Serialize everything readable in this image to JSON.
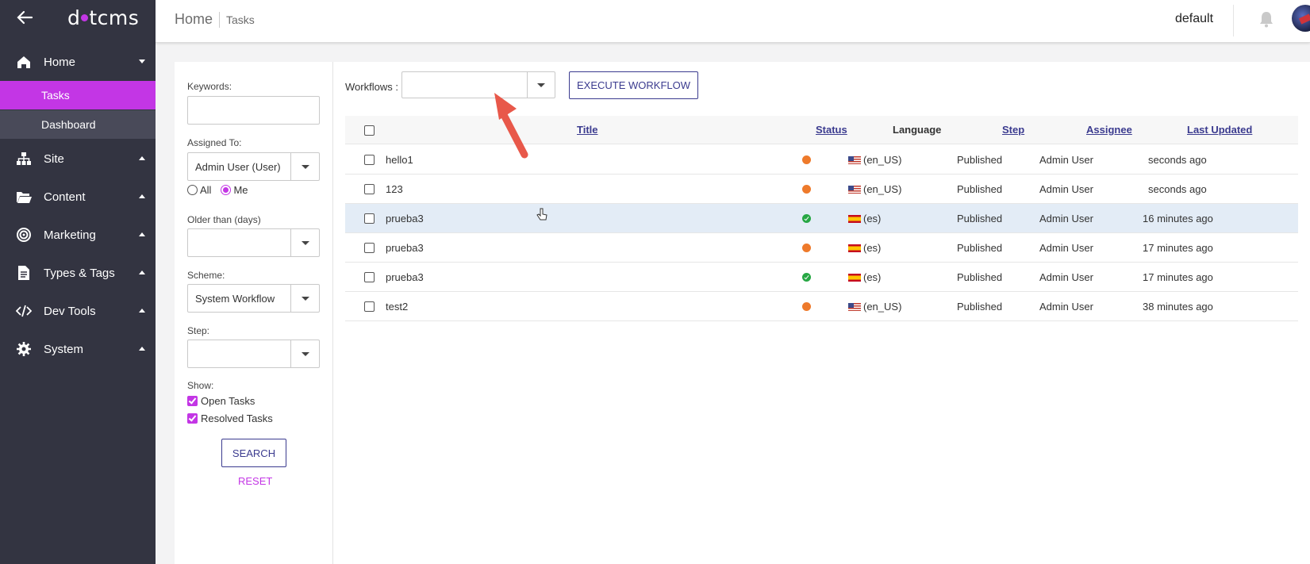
{
  "app": {
    "logo_left": "d",
    "logo_right": "tcms"
  },
  "sidebar": {
    "sections": [
      {
        "label": "Home",
        "icon": "home-icon"
      },
      {
        "label": "Site",
        "icon": "sitemap-icon"
      },
      {
        "label": "Content",
        "icon": "folder-open-icon"
      },
      {
        "label": "Marketing",
        "icon": "target-icon"
      },
      {
        "label": "Types & Tags",
        "icon": "file-text-icon"
      },
      {
        "label": "Dev Tools",
        "icon": "code-icon"
      },
      {
        "label": "System",
        "icon": "gear-icon"
      }
    ],
    "home_items": [
      {
        "label": "Tasks",
        "active": true
      },
      {
        "label": "Dashboard",
        "active": false
      }
    ]
  },
  "header": {
    "home": "Home",
    "page": "Tasks",
    "site": "default"
  },
  "filters": {
    "keywords_label": "Keywords:",
    "keywords_value": "",
    "assigned_label": "Assigned To:",
    "assigned_value": "Admin User (User)",
    "radio_all": "All",
    "radio_me": "Me",
    "older_label": "Older than (days)",
    "older_value": "",
    "scheme_label": "Scheme:",
    "scheme_value": "System Workflow",
    "step_label": "Step:",
    "step_value": "",
    "show_label": "Show:",
    "open_tasks": "Open Tasks",
    "resolved_tasks": "Resolved Tasks",
    "search": "SEARCH",
    "reset": "RESET"
  },
  "toolbar": {
    "workflows_label": "Workflows :",
    "workflows_value": "",
    "execute": "EXECUTE WORKFLOW"
  },
  "table": {
    "headers": {
      "title": "Title",
      "status": "Status",
      "language": "Language",
      "step": "Step",
      "assignee": "Assignee",
      "updated": "Last Updated"
    },
    "rows": [
      {
        "title": "hello1",
        "status": "open",
        "flag": "us",
        "language": "(en_US)",
        "step": "Published",
        "assignee": "Admin User",
        "updated": "seconds ago"
      },
      {
        "title": "123",
        "status": "open",
        "flag": "us",
        "language": "(en_US)",
        "step": "Published",
        "assignee": "Admin User",
        "updated": "seconds ago"
      },
      {
        "title": "prueba3",
        "status": "done",
        "flag": "es",
        "language": "(es)",
        "step": "Published",
        "assignee": "Admin User",
        "updated": "16 minutes ago"
      },
      {
        "title": "prueba3",
        "status": "open",
        "flag": "es",
        "language": "(es)",
        "step": "Published",
        "assignee": "Admin User",
        "updated": "17 minutes ago"
      },
      {
        "title": "prueba3",
        "status": "done",
        "flag": "es",
        "language": "(es)",
        "step": "Published",
        "assignee": "Admin User",
        "updated": "17 minutes ago"
      },
      {
        "title": "test2",
        "status": "open",
        "flag": "us",
        "language": "(en_US)",
        "step": "Published",
        "assignee": "Admin User",
        "updated": "38 minutes ago"
      }
    ]
  },
  "colors": {
    "accent": "#c336e5",
    "sidebar_bg": "#333441",
    "primary": "#3b3b8f",
    "status_open": "#ee7a2b",
    "status_done": "#27a744",
    "arrow": "#e8584a"
  }
}
